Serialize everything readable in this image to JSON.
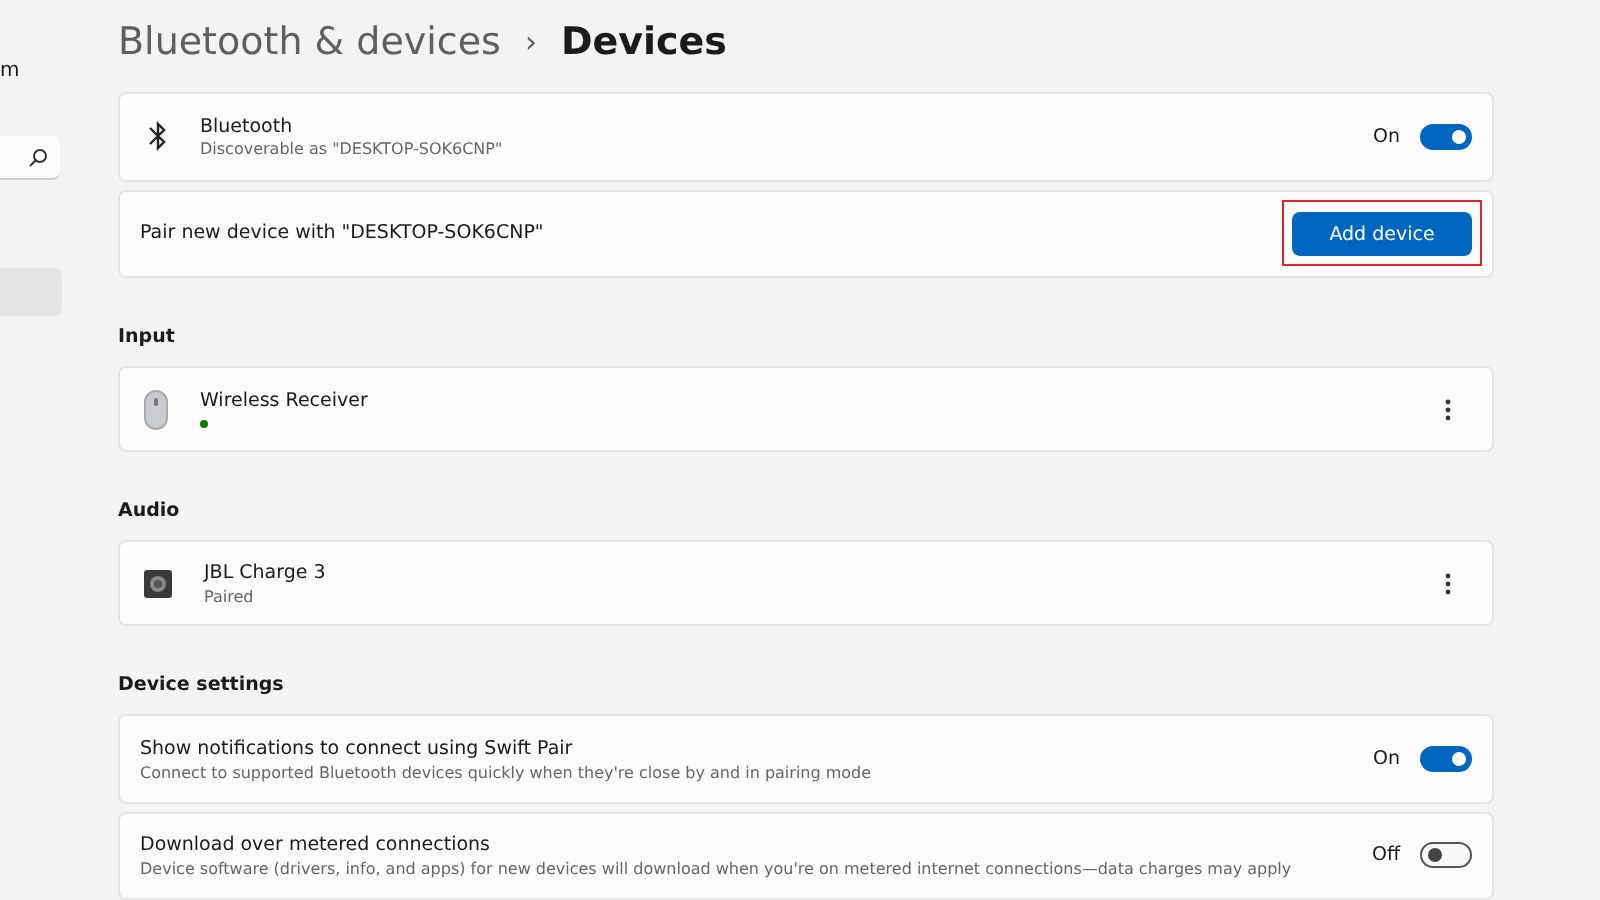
{
  "sidebar": {
    "text_fragment": "m",
    "items": [
      {
        "selected": true
      }
    ]
  },
  "breadcrumb": {
    "parent": "Bluetooth & devices",
    "separator": "›",
    "current": "Devices"
  },
  "bluetooth": {
    "title": "Bluetooth",
    "subtitle": "Discoverable as \"DESKTOP-SOK6CNP\"",
    "toggle_label": "On",
    "on": true
  },
  "pair": {
    "text": "Pair new device with \"DESKTOP-SOK6CNP\"",
    "button": "Add device",
    "highlighted": true
  },
  "sections": [
    {
      "heading": "Input",
      "devices": [
        {
          "kind": "mouse",
          "name": "Wireless Receiver",
          "connected": true
        }
      ]
    },
    {
      "heading": "Audio",
      "devices": [
        {
          "kind": "speaker",
          "name": "JBL Charge 3",
          "status": "Paired",
          "connected": false
        }
      ]
    }
  ],
  "device_settings": {
    "heading": "Device settings",
    "rows": [
      {
        "title": "Show notifications to connect using Swift Pair",
        "subtitle": "Connect to supported Bluetooth devices quickly when they're close by and in pairing mode",
        "toggle_label": "On",
        "on": true
      },
      {
        "title": "Download over metered connections",
        "subtitle": "Device software (drivers, info, and apps) for new devices will download when you're on metered internet connections—data charges may apply",
        "toggle_label": "Off",
        "on": false
      }
    ]
  }
}
